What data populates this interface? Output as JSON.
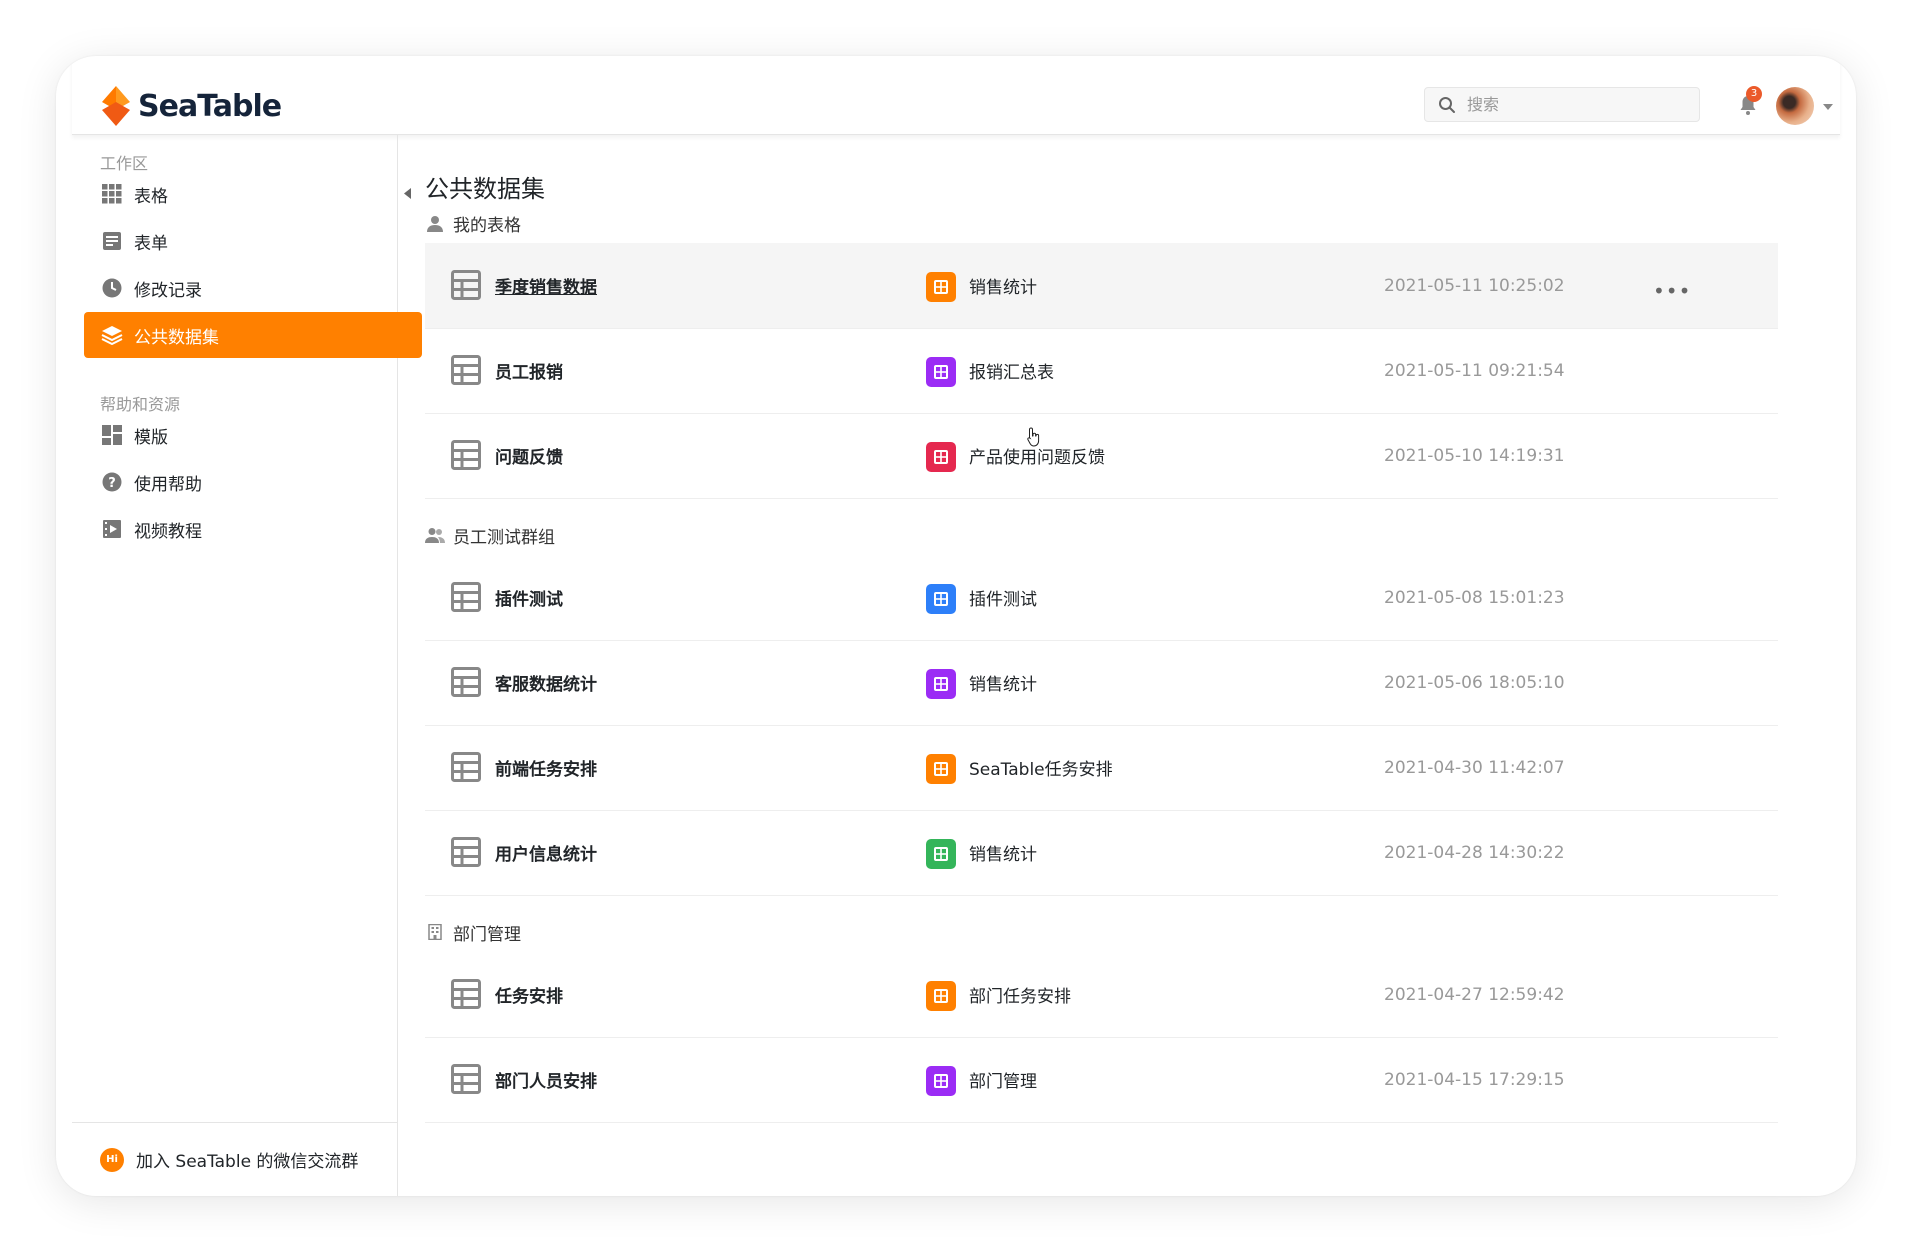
{
  "app": {
    "brand": "SeaTable",
    "accent_color": "#ff8000"
  },
  "header": {
    "search_placeholder": "搜索",
    "notification_count": "3",
    "icons": [
      "search-icon",
      "bell-icon",
      "avatar",
      "chevron-down-icon"
    ]
  },
  "sidebar": {
    "workspace_heading": "工作区",
    "workspace_items": [
      {
        "label": "表格",
        "icon": "grid-icon"
      },
      {
        "label": "表单",
        "icon": "form-icon"
      },
      {
        "label": "修改记录",
        "icon": "clock-icon"
      },
      {
        "label": "公共数据集",
        "icon": "layers-icon",
        "active": true
      }
    ],
    "help_heading": "帮助和资源",
    "help_items": [
      {
        "label": "模版",
        "icon": "template-icon"
      },
      {
        "label": "使用帮助",
        "icon": "question-icon"
      },
      {
        "label": "视频教程",
        "icon": "video-icon"
      }
    ],
    "footer_label": "加入 SeaTable 的微信交流群"
  },
  "main": {
    "title": "公共数据集",
    "groups": [
      {
        "title": "我的表格",
        "icon": "user-icon",
        "rows": [
          {
            "name": "季度销售数据",
            "base": "销售统计",
            "base_color": "#ff8000",
            "time": "2021-05-11 10:25:02",
            "more": "•••"
          },
          {
            "name": "员工报销",
            "base": "报销汇总表",
            "base_color": "#9b2cf5",
            "time": "2021-05-11 09:21:54"
          },
          {
            "name": "问题反馈",
            "base": "产品使用问题反馈",
            "base_color": "#e5284f",
            "time": "2021-05-10 14:19:31"
          }
        ]
      },
      {
        "title": "员工测试群组",
        "icon": "group-icon",
        "rows": [
          {
            "name": "插件测试",
            "base": "插件测试",
            "base_color": "#2d7ff9",
            "time": "2021-05-08 15:01:23"
          },
          {
            "name": "客服数据统计",
            "base": "销售统计",
            "base_color": "#9b2cf5",
            "time": "2021-05-06 18:05:10"
          },
          {
            "name": "前端任务安排",
            "base": "SeaTable任务安排",
            "base_color": "#ff8000",
            "time": "2021-04-30 11:42:07"
          },
          {
            "name": "用户信息统计",
            "base": "销售统计",
            "base_color": "#34b55a",
            "time": "2021-04-28 14:30:22"
          }
        ]
      },
      {
        "title": "部门管理",
        "icon": "building-icon",
        "rows": [
          {
            "name": "任务安排",
            "base": "部门任务安排",
            "base_color": "#ff8000",
            "time": "2021-04-27 12:59:42"
          },
          {
            "name": "部门人员安排",
            "base": "部门管理",
            "base_color": "#9b2cf5",
            "time": "2021-04-15 17:29:15"
          }
        ]
      }
    ]
  }
}
